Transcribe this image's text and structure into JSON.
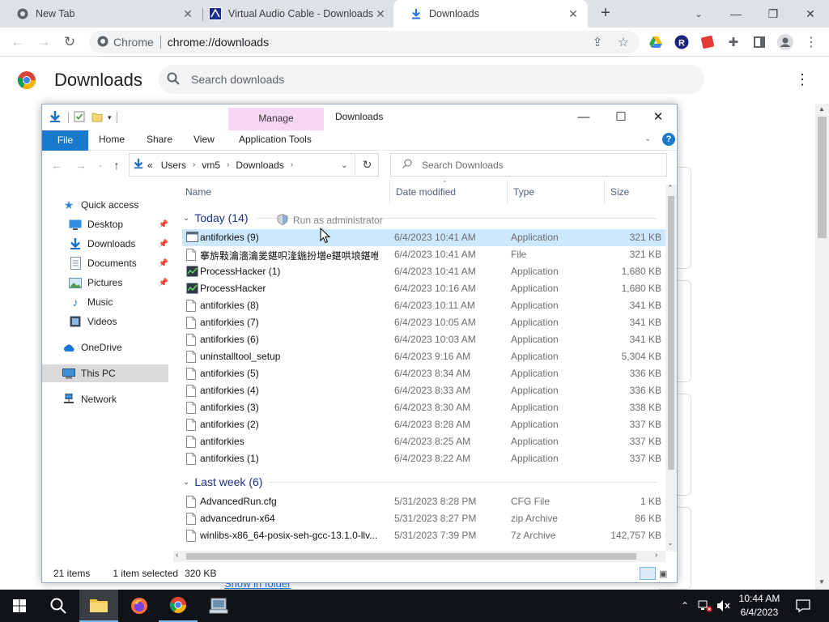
{
  "chrome": {
    "tabs": [
      {
        "title": "New Tab"
      },
      {
        "title": "Virtual Audio Cable - Downloads"
      },
      {
        "title": "Downloads"
      }
    ],
    "omnibox": {
      "scheme_label": "Chrome",
      "url": "chrome://downloads"
    }
  },
  "downloads_page": {
    "title": "Downloads",
    "search_placeholder": "Search downloads",
    "show_in_folder": "Show in folder"
  },
  "explorer": {
    "title": "Downloads",
    "context_tab": "Manage",
    "ribbon_tabs": [
      "File",
      "Home",
      "Share",
      "View",
      "Application Tools"
    ],
    "breadcrumb_overflow": "«",
    "breadcrumb": [
      "Users",
      "vm5",
      "Downloads"
    ],
    "search_placeholder": "Search Downloads",
    "nav": {
      "quick_access": "Quick access",
      "desktop": "Desktop",
      "downloads": "Downloads",
      "documents": "Documents",
      "pictures": "Pictures",
      "music": "Music",
      "videos": "Videos",
      "onedrive": "OneDrive",
      "this_pc": "This PC",
      "network": "Network"
    },
    "columns": {
      "name": "Name",
      "date": "Date modified",
      "type": "Type",
      "size": "Size"
    },
    "groups": {
      "today": "Today (14)",
      "last_week": "Last week (6)"
    },
    "today_files": [
      {
        "name": "antiforkies (9)",
        "date": "6/4/2023 10:41 AM",
        "type": "Application",
        "size": "321 KB",
        "icon": "app-window-icon"
      },
      {
        "name": "搴旂敤瀹濇瀹夎鍖呮湰鍦扮増e鍖哄埌鍖咃",
        "date": "6/4/2023 10:41 AM",
        "type": "File",
        "size": "321 KB",
        "icon": "file-icon"
      },
      {
        "name": "ProcessHacker (1)",
        "date": "6/4/2023 10:41 AM",
        "type": "Application",
        "size": "1,680 KB",
        "icon": "process-hacker-icon"
      },
      {
        "name": "ProcessHacker",
        "date": "6/4/2023 10:16 AM",
        "type": "Application",
        "size": "1,680 KB",
        "icon": "process-hacker-icon"
      },
      {
        "name": "antiforkies (8)",
        "date": "6/4/2023 10:11 AM",
        "type": "Application",
        "size": "341 KB",
        "icon": "file-icon"
      },
      {
        "name": "antiforkies (7)",
        "date": "6/4/2023 10:05 AM",
        "type": "Application",
        "size": "341 KB",
        "icon": "file-icon"
      },
      {
        "name": "antiforkies (6)",
        "date": "6/4/2023 10:03 AM",
        "type": "Application",
        "size": "341 KB",
        "icon": "file-icon"
      },
      {
        "name": "uninstalltool_setup",
        "date": "6/4/2023 9:16 AM",
        "type": "Application",
        "size": "5,304 KB",
        "icon": "file-icon"
      },
      {
        "name": "antiforkies (5)",
        "date": "6/4/2023 8:34 AM",
        "type": "Application",
        "size": "336 KB",
        "icon": "file-icon"
      },
      {
        "name": "antiforkies (4)",
        "date": "6/4/2023 8:33 AM",
        "type": "Application",
        "size": "336 KB",
        "icon": "file-icon"
      },
      {
        "name": "antiforkies (3)",
        "date": "6/4/2023 8:30 AM",
        "type": "Application",
        "size": "338 KB",
        "icon": "file-icon"
      },
      {
        "name": "antiforkies (2)",
        "date": "6/4/2023 8:28 AM",
        "type": "Application",
        "size": "337 KB",
        "icon": "file-icon"
      },
      {
        "name": "antiforkies",
        "date": "6/4/2023 8:25 AM",
        "type": "Application",
        "size": "337 KB",
        "icon": "file-icon"
      },
      {
        "name": "antiforkies (1)",
        "date": "6/4/2023 8:22 AM",
        "type": "Application",
        "size": "337 KB",
        "icon": "file-icon"
      }
    ],
    "last_week_files": [
      {
        "name": "AdvancedRun.cfg",
        "date": "5/31/2023 8:28 PM",
        "type": "CFG File",
        "size": "1 KB",
        "icon": "file-icon"
      },
      {
        "name": "advancedrun-x64",
        "date": "5/31/2023 8:27 PM",
        "type": "zip Archive",
        "size": "86 KB",
        "icon": "file-icon"
      },
      {
        "name": "winlibs-x86_64-posix-seh-gcc-13.1.0-llv...",
        "date": "5/31/2023 7:39 PM",
        "type": "7z Archive",
        "size": "142,757 KB",
        "icon": "file-icon"
      }
    ],
    "tooltip": "Run as administrator",
    "status": {
      "count": "21 items",
      "selected": "1 item selected",
      "size": "320 KB"
    }
  },
  "taskbar": {
    "time": "10:44 AM",
    "date": "6/4/2023"
  },
  "colors": {
    "selection": "#cce8ff",
    "file_tab": "#1979ca",
    "manage_tab": "#f6d6f4",
    "group_header": "#1e3287",
    "taskbar": "#101418"
  }
}
